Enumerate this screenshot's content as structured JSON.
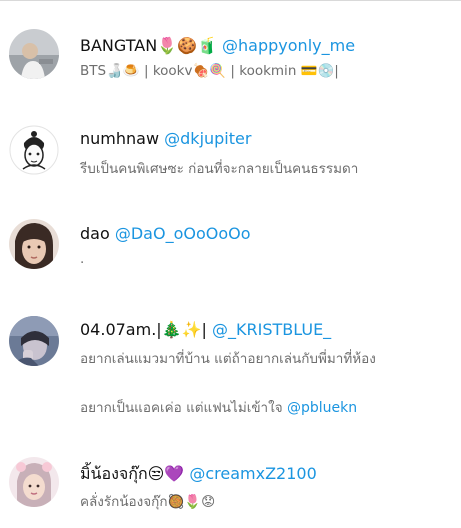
{
  "accounts": [
    {
      "display_name": "BANGTAN🌷🍪🧃",
      "handle": "@happyonly_me",
      "bio": "BTS🍶🍮 | kookv🍖🍭 | kookmin 💳💿|"
    },
    {
      "display_name": "numhnaw",
      "handle": "@dkjupiter",
      "bio": "รีบเป็นคนพิเศษซะ ก่อนที่จะกลายเป็นคนธรรมดา"
    },
    {
      "display_name": "dao",
      "handle": "@DaO_oOoOoOo",
      "bio": "."
    },
    {
      "display_name": "04.07am.|🎄✨|",
      "handle": "@_KRISTBLUE_",
      "bio_line1": "อยากเล่นแมวมาที่บ้าน แต่ถ้าอยากเล่นกับพี่มาที่ห้อง",
      "bio_line2": "อยากเป็นแอคเค่อ แต่แฟนไม่เข้าใจ",
      "bio_mention": "@pbluekn"
    },
    {
      "display_name": "มิ้น้องจกุ๊ก😒💜",
      "handle": "@creamxZ2100",
      "bio": "คลั่งรักน้องจกุ๊ก🥘🌷😟"
    }
  ],
  "colors": {
    "link": "#1b95e0",
    "bio_text": "#6e6e6e",
    "name_text": "#111111",
    "divider": "#d9d9d9"
  }
}
